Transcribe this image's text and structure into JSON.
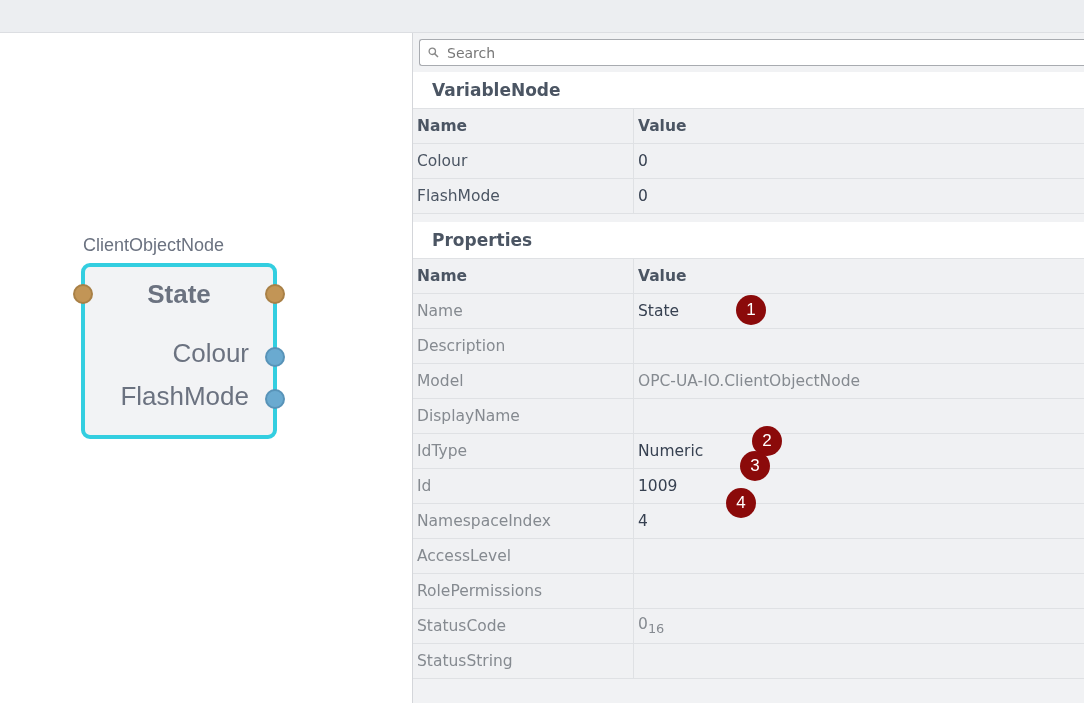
{
  "node": {
    "type_label": "ClientObjectNode",
    "title": "State",
    "outputs": [
      "Colour",
      "FlashMode"
    ]
  },
  "search": {
    "placeholder": "Search"
  },
  "sections": [
    {
      "title": "VariableNode",
      "readonly_names": false,
      "columns": [
        "Name",
        "Value"
      ],
      "rows": [
        {
          "name": "Colour",
          "value": "0",
          "editable": true
        },
        {
          "name": "FlashMode",
          "value": "0",
          "editable": true
        }
      ]
    },
    {
      "title": "Properties",
      "readonly_names": true,
      "columns": [
        "Name",
        "Value"
      ],
      "rows": [
        {
          "name": "Name",
          "value": "State",
          "editable": true
        },
        {
          "name": "Description"
        },
        {
          "name": "Model",
          "value": "OPC-UA-IO.ClientObjectNode",
          "editable": false
        },
        {
          "name": "DisplayName"
        },
        {
          "name": "IdType",
          "value": "Numeric",
          "editable": true
        },
        {
          "name": "Id",
          "value": "1009",
          "editable": true
        },
        {
          "name": "NamespaceIndex",
          "value": "4",
          "editable": true
        },
        {
          "name": "AccessLevel"
        },
        {
          "name": "RolePermissions"
        },
        {
          "name": "StatusCode",
          "value": "0$_{16}$",
          "editable": false
        },
        {
          "name": "StatusString"
        }
      ]
    }
  ],
  "callouts": [
    "1",
    "2",
    "3",
    "4"
  ]
}
